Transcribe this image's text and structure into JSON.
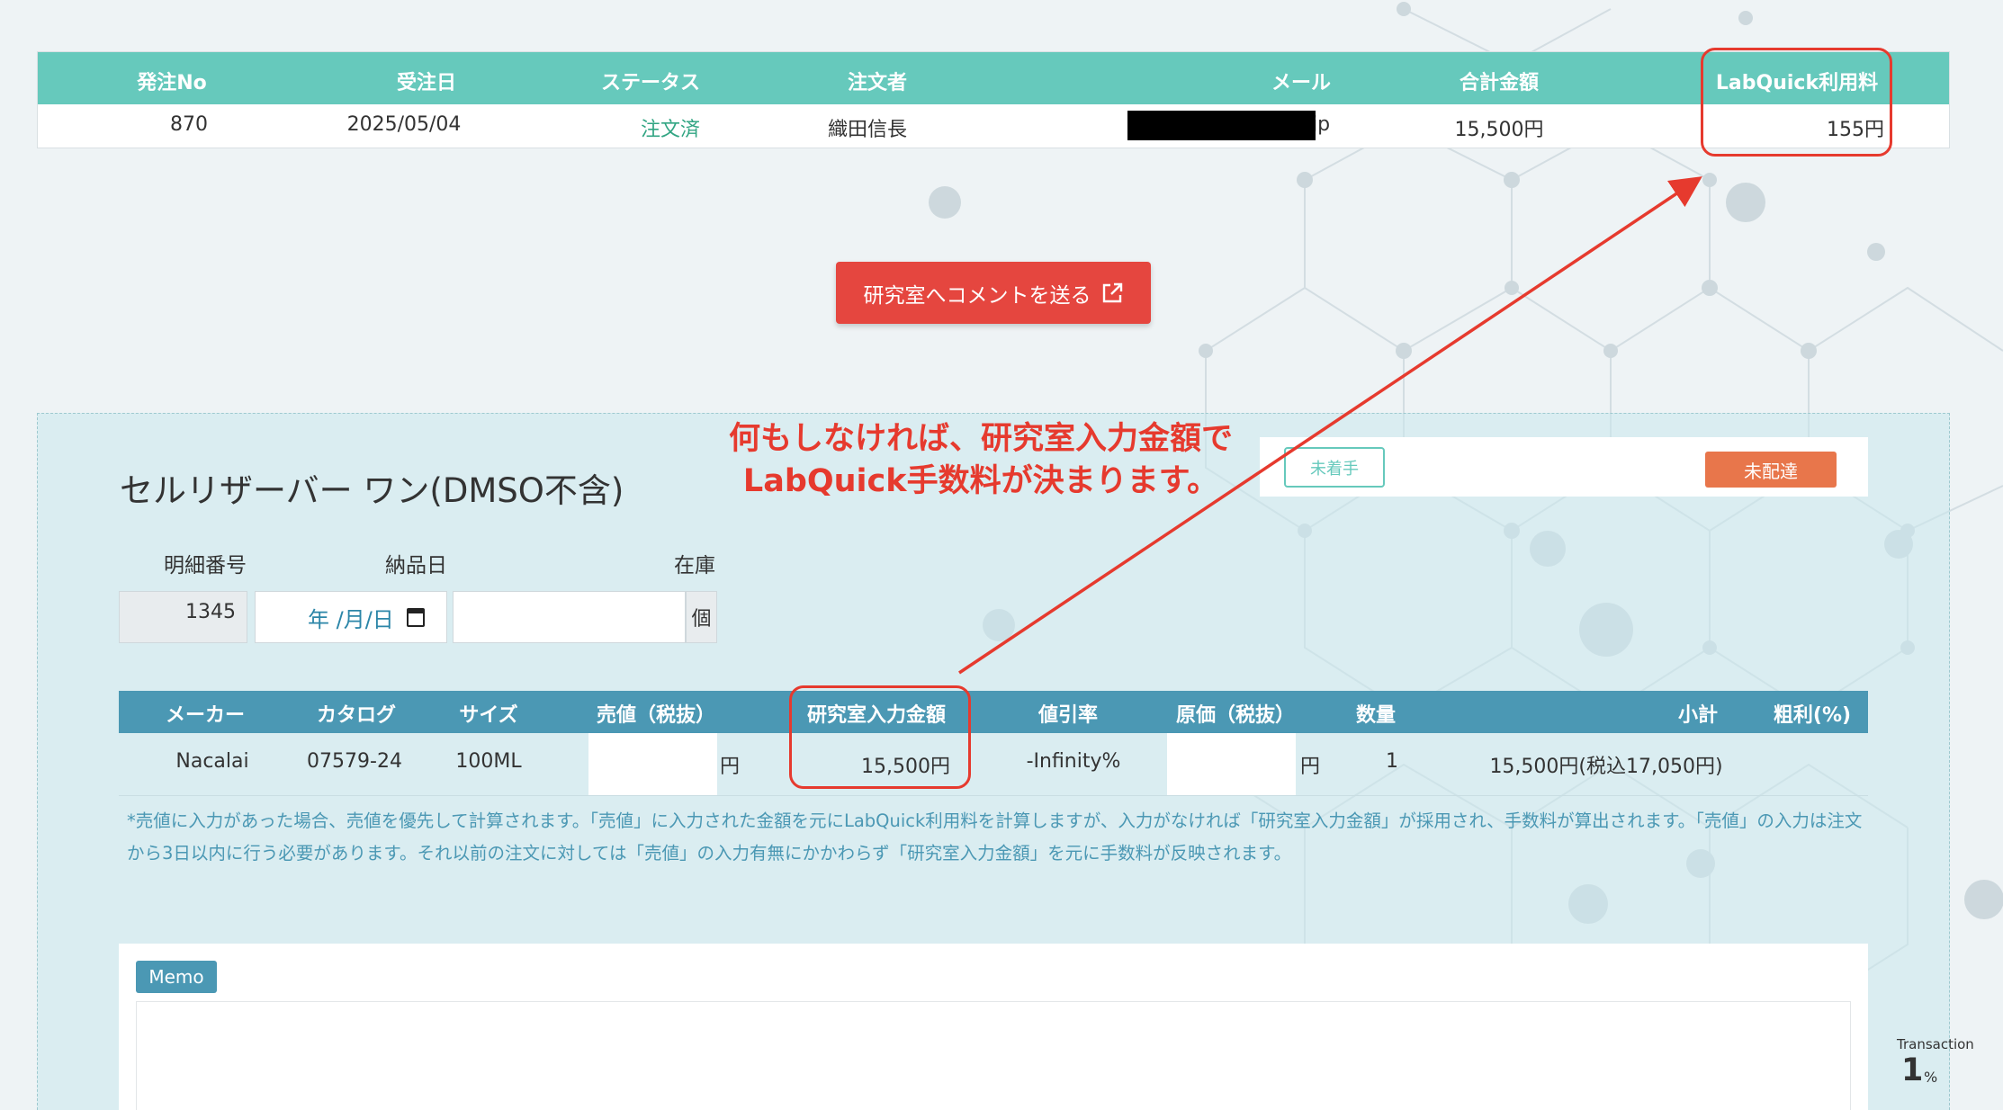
{
  "order": {
    "headers": [
      "発注No",
      "受注日",
      "ステータス",
      "注文者",
      "メール",
      "合計金額",
      "LabQuick利用料"
    ],
    "row": {
      "order_no": "870",
      "date": "2025/05/04",
      "status": "注文済",
      "orderer": "織田信長",
      "email_suffix": "o.co.jp",
      "total": "15,500円",
      "fee": "155円"
    }
  },
  "comment_button": {
    "label": "研究室へコメントを送る",
    "icon": "external-link-icon"
  },
  "annotation": {
    "line1": "何もしなければ、研究室入力金額で",
    "line2": "LabQuick手数料が決まります。"
  },
  "item": {
    "title": "セルリザーバー ワン(DMSO不含)",
    "badge_status": "未着手",
    "badge_delivery": "未配達",
    "labels": {
      "detail_no": "明細番号",
      "delivery_date": "納品日",
      "stock": "在庫"
    },
    "detail_no": "1345",
    "date_placeholder": "年 /月/日",
    "stock_unit": "個",
    "columns": [
      "メーカー",
      "カタログ",
      "サイズ",
      "売値（税抜）",
      "研究室入力金額",
      "値引率",
      "原価（税抜）",
      "数量",
      "小計",
      "粗利(%)"
    ],
    "row": {
      "maker": "Nacalai",
      "catalog": "07579-24",
      "size": "100ML",
      "sell_unit": "円",
      "lab_price": "15,500円",
      "discount": "-Infinity%",
      "cost_unit": "円",
      "qty": "1",
      "subtotal": "15,500円(税込17,050円)"
    },
    "note": "*売値に入力があった場合、売値を優先して計算されます。「売値」に入力された金額を元にLabQuick利用料を計算しますが、入力がなければ「研究室入力金額」が採用され、手数料が算出されます。「売値」の入力は注文から3日以内に行う必要があります。それ以前の注文に対しては「売値」の入力有無にかかわらず「研究室入力金額」を元に手数料が反映されます。"
  },
  "memo": {
    "label": "Memo"
  },
  "transaction": {
    "label": "Transaction",
    "value": "1",
    "unit": "%"
  },
  "colors": {
    "teal": "#66c9bc",
    "blue": "#4b98b4",
    "red": "#e63a2e",
    "orange": "#e8764b"
  }
}
